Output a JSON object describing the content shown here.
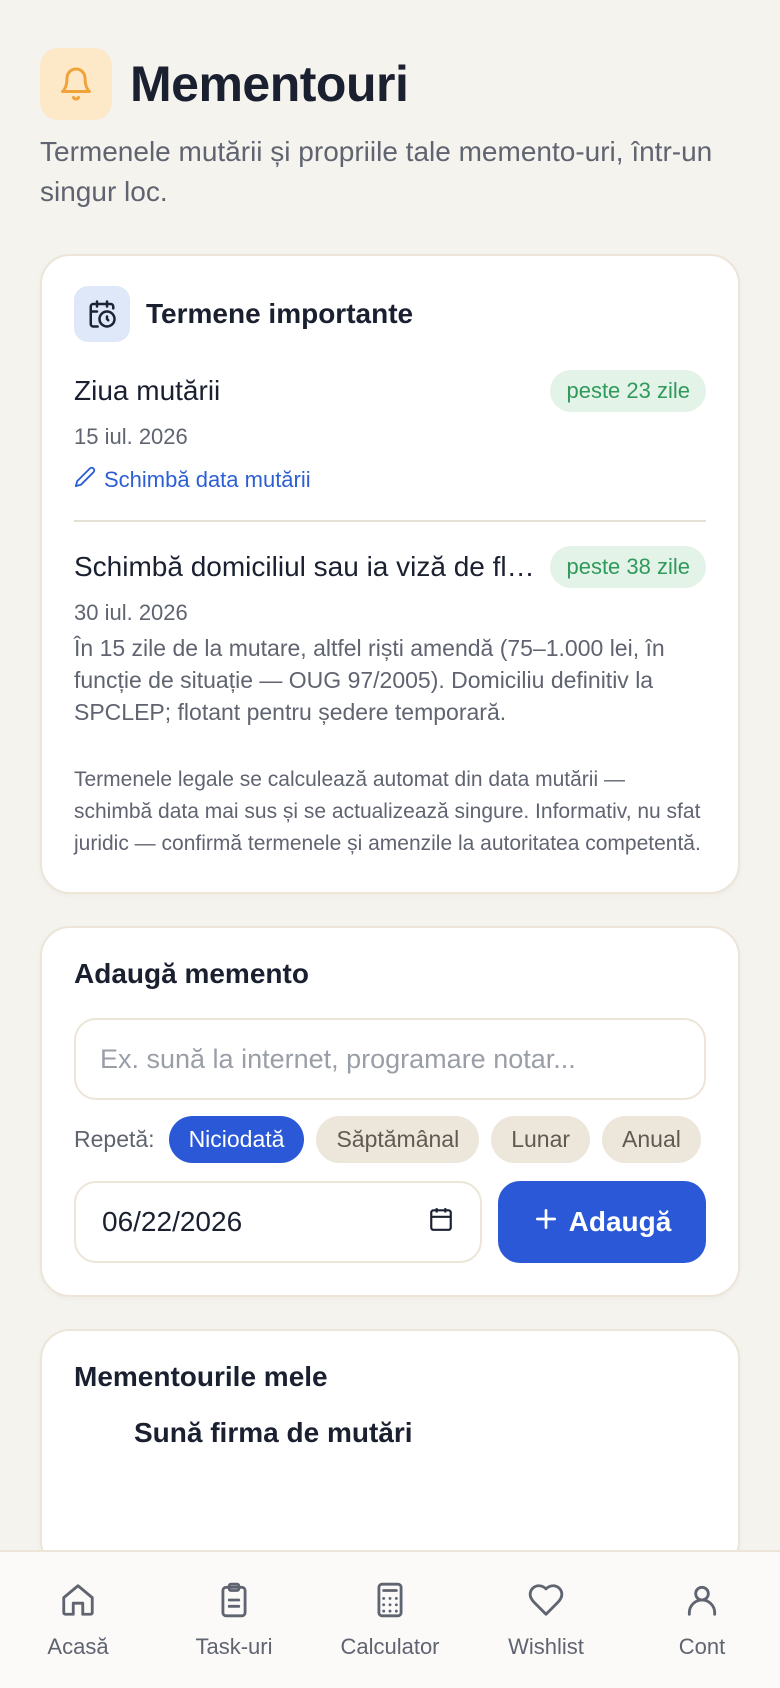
{
  "header": {
    "title": "Mementouri",
    "subtitle": "Termenele mutării și propriile tale memento-uri, într-un singur loc.",
    "icon": "bell-icon",
    "icon_color": "#f0a23b"
  },
  "deadlines": {
    "title": "Termene importante",
    "icon": "calendar-clock-icon",
    "items": [
      {
        "title": "Ziua mutării",
        "badge": "peste 23 zile",
        "date": "15 iul. 2026",
        "link": "Schimbă data mutării"
      },
      {
        "title": "Schimbă domiciliul sau ia viză de flotant",
        "badge": "peste 38 zile",
        "date": "30 iul. 2026",
        "description": "În 15 zile de la mutare, altfel riști amendă (75–1.000 lei, în funcție de situație — OUG 97/2005). Domiciliu definitiv la SPCLEP; flotant pentru ședere temporară."
      }
    ],
    "note": "Termenele legale se calculează automat din data mutării — schimbă data mai sus și se actualizează singure. Informativ, nu sfat juridic — confirmă termenele și amenzile la autoritatea competentă."
  },
  "add_reminder": {
    "title": "Adaugă memento",
    "placeholder": "Ex. sună la internet, programare notar...",
    "repeat_label": "Repetă:",
    "options": [
      "Niciodată",
      "Săptămânal",
      "Lunar",
      "Anual"
    ],
    "selected": "Niciodată",
    "date_value": "06/22/2026",
    "add_label": "Adaugă"
  },
  "my_reminders": {
    "title": "Mementourile mele",
    "peek_item": "Sună firma de mutări"
  },
  "nav": [
    {
      "label": "Acasă",
      "icon": "home-icon"
    },
    {
      "label": "Task-uri",
      "icon": "clipboard-icon"
    },
    {
      "label": "Calculator",
      "icon": "calculator-icon"
    },
    {
      "label": "Wishlist",
      "icon": "heart-icon"
    },
    {
      "label": "Cont",
      "icon": "user-icon"
    }
  ],
  "colors": {
    "accent": "#2b58d6",
    "badge_bg": "#e4f3e8",
    "badge_text": "#2f9a5b",
    "background": "#f5f3ee"
  }
}
